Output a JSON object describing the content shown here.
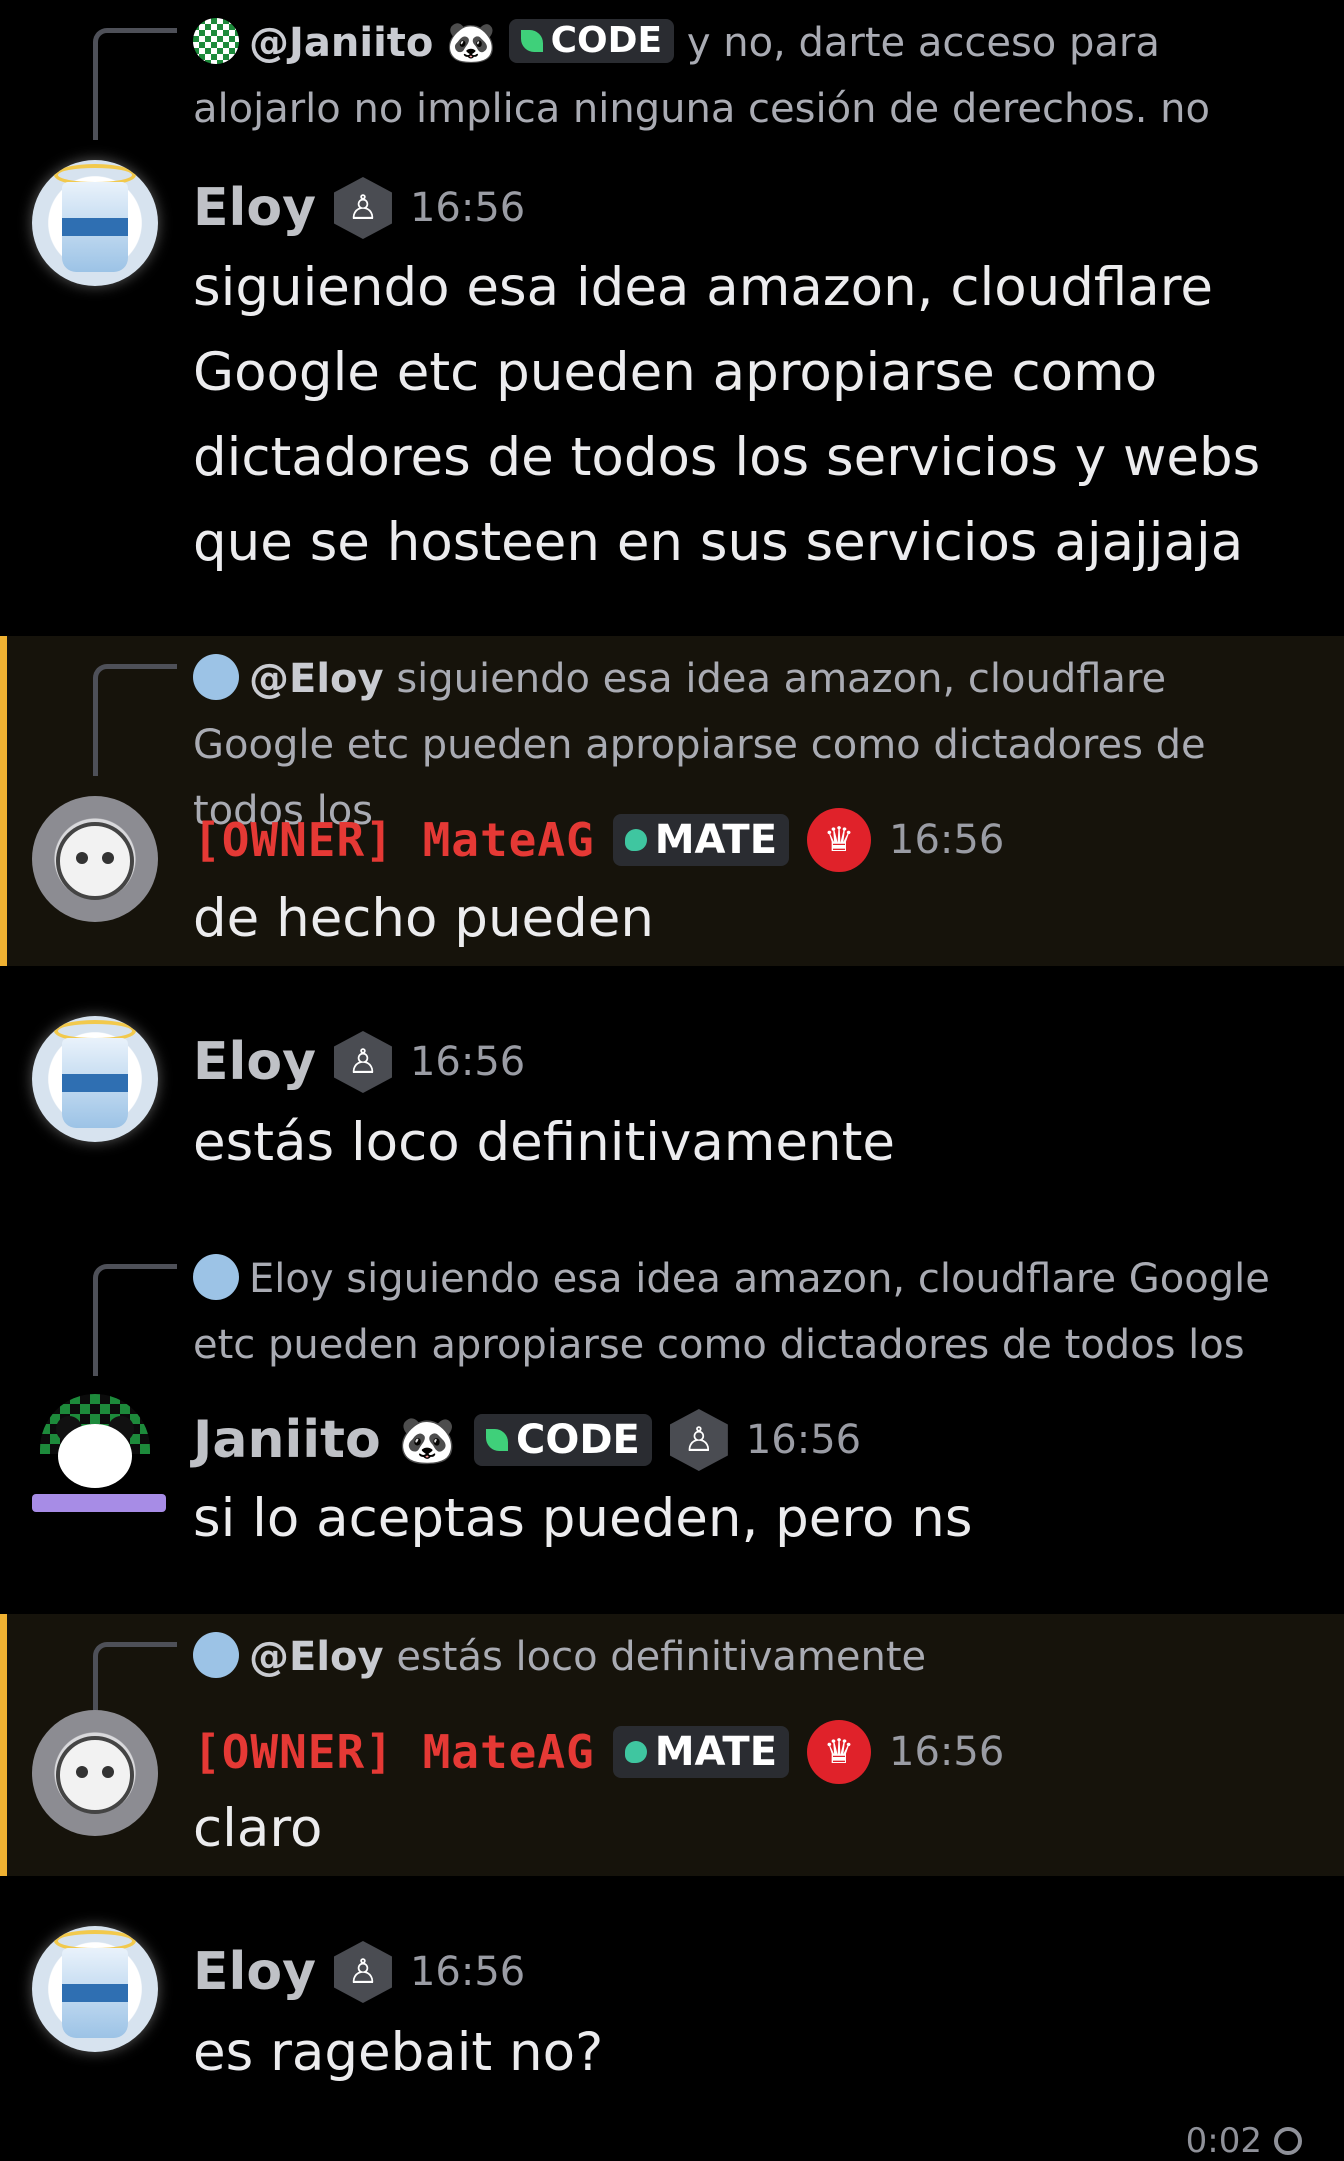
{
  "messages": [
    {
      "reply": {
        "author": "@Janiito",
        "emoji": "🐼",
        "tag": "CODE",
        "text": "y no, darte acceso para alojarlo no implica ninguna cesión de derechos. no"
      },
      "author": "Eloy",
      "time": "16:56",
      "text": "siguiendo esa idea amazon, cloudflare Google etc pueden apropiarse como dictadores de todos los servicios y webs que se hosteen en sus servicios ajajjaja"
    },
    {
      "reply": {
        "author": "@Eloy",
        "text": "siguiendo esa idea amazon, cloudflare Google etc pueden apropiarse como dictadores de todos los"
      },
      "author_prefix": "[OWNER]",
      "author": "MateAG",
      "tag": "MATE",
      "crown": "♛",
      "time": "16:56",
      "text": "de hecho pueden"
    },
    {
      "author": "Eloy",
      "time": "16:56",
      "text": "estás loco definitivamente"
    },
    {
      "reply": {
        "author": "Eloy",
        "text": "siguiendo esa idea amazon, cloudflare Google etc pueden apropiarse como dictadores de todos los"
      },
      "author": "Janiito",
      "emoji": "🐼",
      "tag": "CODE",
      "time": "16:56",
      "text": "si lo aceptas pueden, pero ns"
    },
    {
      "reply": {
        "author": "@Eloy",
        "text": "estás loco definitivamente"
      },
      "author_prefix": "[OWNER]",
      "author": "MateAG",
      "tag": "MATE",
      "crown": "♛",
      "time": "16:56",
      "text": "claro"
    },
    {
      "author": "Eloy",
      "time": "16:56",
      "text": "es ragebait no?"
    }
  ],
  "status": {
    "elapsed": "0:02"
  },
  "icons": {
    "role_badge": "person-hex-icon",
    "crown": "crown-icon",
    "leaf": "leaf-icon"
  },
  "colors": {
    "highlight_bar": "#f0b232",
    "owner_name": "#e53935",
    "code_leaf": "#3fd07a"
  }
}
